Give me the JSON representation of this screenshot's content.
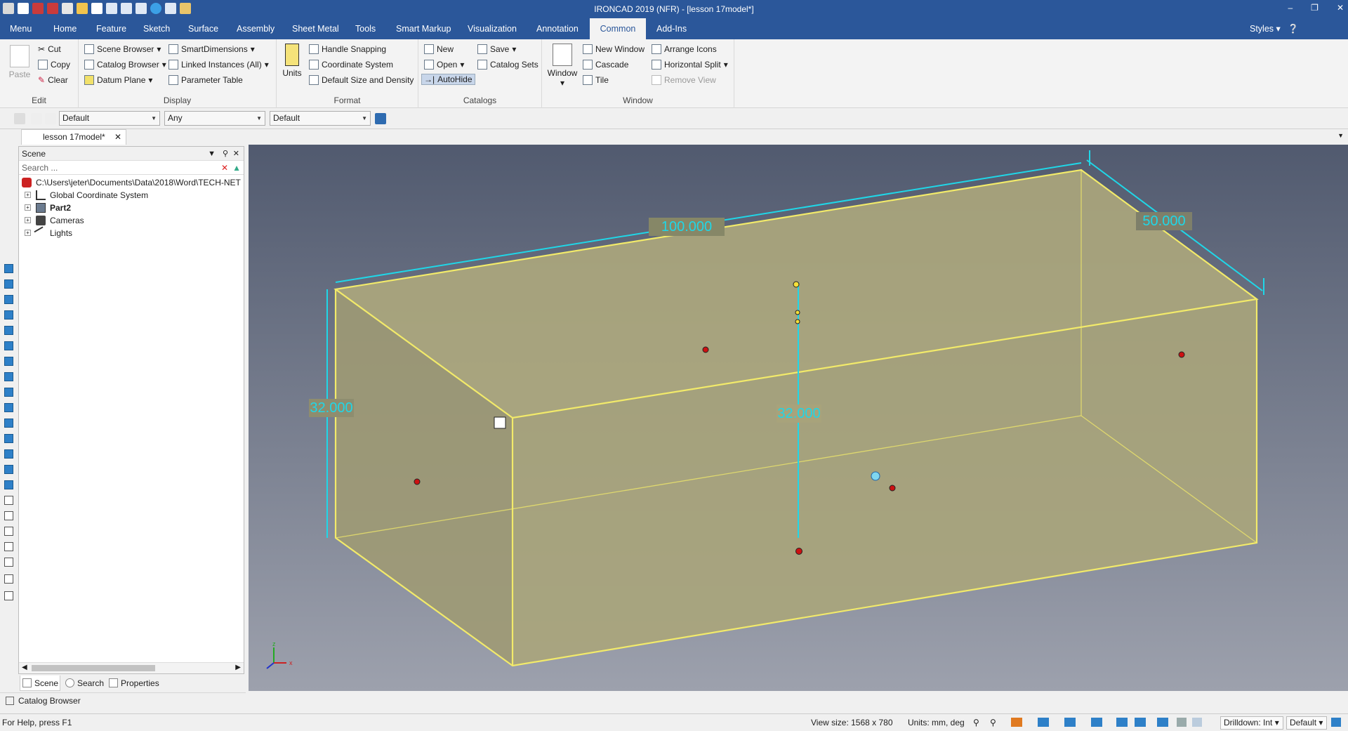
{
  "titlebar": {
    "title": "IRONCAD 2019 (NFR) - [lesson 17model*]"
  },
  "menubar": {
    "tabs": [
      "Menu",
      "Home",
      "Feature",
      "Sketch",
      "Surface",
      "Assembly",
      "Sheet Metal",
      "Tools",
      "Smart Markup",
      "Visualization",
      "Annotation",
      "Common",
      "Add-Ins"
    ],
    "active": "Common",
    "styles_label": "Styles"
  },
  "ribbon": {
    "edit": {
      "label": "Edit",
      "paste": "Paste",
      "cut": "Cut",
      "copy": "Copy",
      "clear": "Clear"
    },
    "display": {
      "label": "Display",
      "scene_browser": "Scene Browser",
      "catalog_browser": "Catalog Browser",
      "datum_plane": "Datum Plane",
      "smart_dimensions": "SmartDimensions",
      "linked_instances": "Linked Instances (All)",
      "parameter_table": "Parameter Table"
    },
    "format": {
      "label": "Format",
      "units": "Units",
      "handle_snapping": "Handle Snapping",
      "coordinate_system": "Coordinate System",
      "default_size": "Default Size and Density"
    },
    "catalogs": {
      "label": "Catalogs",
      "new": "New",
      "open": "Open",
      "autohide": "AutoHide",
      "save": "Save",
      "catalog_sets": "Catalog Sets"
    },
    "window": {
      "label": "Window",
      "window": "Window",
      "new_window": "New Window",
      "cascade": "Cascade",
      "tile": "Tile",
      "arrange_icons": "Arrange Icons",
      "horizontal_split": "Horizontal Split",
      "remove_view": "Remove View"
    }
  },
  "toolbar2": {
    "combo1": "Default",
    "combo2": "Any",
    "combo3": "Default"
  },
  "doc_tab": {
    "label": "lesson 17model*"
  },
  "scene": {
    "title": "Scene",
    "search_placeholder": "Search ...",
    "root": "C:\\Users\\jeter\\Documents\\Data\\2018\\Word\\TECH-NET\\",
    "items": [
      "Global Coordinate System",
      "Part2",
      "Cameras",
      "Lights"
    ]
  },
  "panel_tabs": {
    "scene": "Scene",
    "search": "Search",
    "properties": "Properties"
  },
  "catalog_browser_tab": "Catalog Browser",
  "viewport": {
    "dim_length": "100.000",
    "dim_width": "50.000",
    "dim_height_left": "32.000",
    "dim_height_center": "32.000",
    "axis_z": "z",
    "axis_x": "x",
    "colors": {
      "box_fill": "#c9c08a",
      "box_edge": "#f2ea6a",
      "dim_color": "#1fd7e8"
    }
  },
  "statusbar": {
    "help": "For Help, press F1",
    "view_size": "View size: 1568 x  780",
    "units": "Units: mm, deg",
    "drilldown": "Drilldown: Int",
    "style": "Default"
  }
}
